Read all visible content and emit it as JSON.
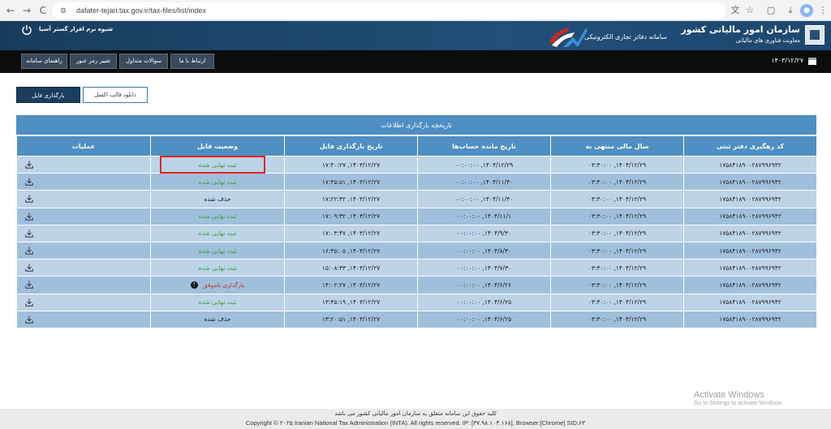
{
  "browser": {
    "url": "dafater-tejari.tax.gov.ir/tax-files/list/index",
    "back_glyph": "←",
    "forward_glyph": "→",
    "reload_glyph": "C"
  },
  "header": {
    "org_name": "سازمان امور مالیاتی کشور",
    "org_subtitle": "معاونت فناوری های مالیاتی",
    "system_title": "سامانه دفاتر تجاری الکترونیکی",
    "user_label": "شیوه نرم افزار گستر آسیا"
  },
  "menu": {
    "items": [
      "ارتباط با ما",
      "سوالات متداول",
      "تغییر رمز عبور",
      "راهنمای سامانه"
    ],
    "date": "۱۴۰۳/۱۲/۲۷"
  },
  "actions": {
    "upload_label": "بارگذاری فایل",
    "template_label": "دانلود قالب اکسل"
  },
  "table": {
    "title": "تاریخچه بارگذاری اطلاعات",
    "headers": [
      "کد رهگیری دفتر ثبتی",
      "سال مالی منتهی به",
      "تاریخ مانده حساب‌ها",
      "تاریخ بارگذاری فایل",
      "وضعیت فایل",
      "عملیات"
    ],
    "rows": [
      {
        "code": "۱۷۵۸۴۱۸۹۰۰۲۸۷۹۹۶۹۴۲",
        "fiscal": "۱۴۰۴/۱۲/۲۹, ۰۳:۳۰:۰۰",
        "balance": "۱۴۰۴/۱۲/۲۹, ۰۰:۰۰:۰۰",
        "upload": "۱۴۰۳/۱۲/۲۷, ۱۷:۴۰:۲۷",
        "status": "ثبت نهایی شده",
        "status_type": "success"
      },
      {
        "code": "۱۷۵۸۴۱۸۹۰۰۲۸۷۹۹۶۹۴۲",
        "fiscal": "۱۴۰۴/۱۲/۲۹, ۰۳:۳۰:۰۰",
        "balance": "۱۴۰۴/۱۱/۳۰, ۰۰:۰۰:۰۰",
        "upload": "۱۴۰۳/۱۲/۲۷, ۱۷:۳۵:۵۱",
        "status": "ثبت نهایی شده",
        "status_type": "success"
      },
      {
        "code": "۱۷۵۸۴۱۸۹۰۰۲۸۷۹۹۶۹۴۲",
        "fiscal": "۱۴۰۴/۱۲/۲۹, ۰۳:۳۰:۰۰",
        "balance": "۱۴۰۴/۱۱/۳۰, ۰۰:۰۰:۰۰",
        "upload": "۱۴۰۳/۱۲/۲۷, ۱۷:۲۲:۳۲",
        "status": "حذف شده",
        "status_type": "deleted"
      },
      {
        "code": "۱۷۵۸۴۱۸۹۰۰۲۸۷۹۹۶۹۴۲",
        "fiscal": "۱۴۰۴/۱۲/۲۹, ۰۳:۳۰:۰۰",
        "balance": "۱۴۰۴/۱۱/۱, ۰۰:۰۰:۰۰",
        "upload": "۱۴۰۳/۱۲/۲۷, ۱۷:۰۹:۳۲",
        "status": "ثبت نهایی شده",
        "status_type": "success"
      },
      {
        "code": "۱۷۵۸۴۱۸۹۰۰۲۸۷۹۹۶۹۴۲",
        "fiscal": "۱۴۰۴/۱۲/۲۹, ۰۳:۳۰:۰۰",
        "balance": "۱۴۰۴/۹/۳۰, ۰۰:۰۰:۰۰",
        "upload": "۱۴۰۳/۱۲/۲۷, ۱۷:۰۳:۴۷",
        "status": "ثبت نهایی شده",
        "status_type": "success"
      },
      {
        "code": "۱۷۵۸۴۱۸۹۰۰۲۸۷۹۹۶۹۴۲",
        "fiscal": "۱۴۰۴/۱۲/۲۹, ۰۳:۳۰:۰۰",
        "balance": "۱۴۰۴/۸/۳۰, ۰۰:۰۰:۰۰",
        "upload": "۱۴۰۳/۱۲/۲۷, ۱۶:۴۵:۰۵",
        "status": "ثبت نهایی شده",
        "status_type": "success"
      },
      {
        "code": "۱۷۵۸۴۱۸۹۰۰۲۸۷۹۹۶۹۴۲",
        "fiscal": "۱۴۰۴/۱۲/۲۹, ۰۳:۳۰:۰۰",
        "balance": "۱۴۰۴/۷/۳۰, ۰۰:۰۰:۰۰",
        "upload": "۱۴۰۳/۱۲/۲۷, ۱۵:۰۸:۳۳",
        "status": "ثبت نهایی شده",
        "status_type": "success"
      },
      {
        "code": "۱۷۵۸۴۱۸۹۰۰۲۸۷۹۹۶۹۴۲",
        "fiscal": "۱۴۰۴/۱۲/۲۹, ۰۳:۳۰:۰۰",
        "balance": "۱۴۰۴/۶/۲۶, ۰۰:۰۰:۰۰",
        "upload": "۱۴۰۳/۱۲/۲۷, ۱۴:۰۲:۲۷",
        "status": "بارگذاری ناموفق",
        "status_type": "failed"
      },
      {
        "code": "۱۷۵۸۴۱۸۹۰۰۲۸۷۹۹۶۹۴۲",
        "fiscal": "۱۴۰۴/۱۲/۲۹, ۰۳:۳۰:۰۰",
        "balance": "۱۴۰۴/۶/۲۵, ۰۰:۰۰:۰۰",
        "upload": "۱۴۰۳/۱۲/۲۷, ۱۳:۳۵:۱۹",
        "status": "ثبت نهایی شده",
        "status_type": "success"
      },
      {
        "code": "۱۷۵۸۴۱۸۹۰۰۲۸۷۹۹۶۹۴۲",
        "fiscal": "۱۴۰۴/۱۲/۲۹, ۰۳:۳۰:۰۰",
        "balance": "۱۴۰۴/۶/۲۵, ۰۰:۰۰:۰۰",
        "upload": "۱۴۰۳/۱۲/۲۷, ۱۳:۲۰:۵۱",
        "status": "حذف شده",
        "status_type": "deleted"
      }
    ]
  },
  "watermark": {
    "line1": "Activate Windows",
    "line2": "Go to Settings to activate Windows."
  },
  "footer": {
    "fa": "کلیه حقوق این سامانه متعلق به سازمان امور مالیاتی کشور می باشد",
    "en": "Copyright © ۲۰۲۵ Iranian National Tax Administration (INTA). All rights reserved. IP: [۳۷.۹۸.۱۰۴.۱۶۸], Browser:[Chrome] SID:۶۳"
  },
  "colors": {
    "header_bg": "#1d4870",
    "table_header": "#4f8fc3",
    "row_light": "#bcd3e8",
    "row_dark": "#9fbfdd",
    "success": "#3a9d3a",
    "failed": "#c0362c",
    "highlight": "#e0251f"
  },
  "icons": {
    "download": "download-icon",
    "power": "power-icon",
    "calendar": "calendar-icon",
    "info": "info-icon"
  }
}
